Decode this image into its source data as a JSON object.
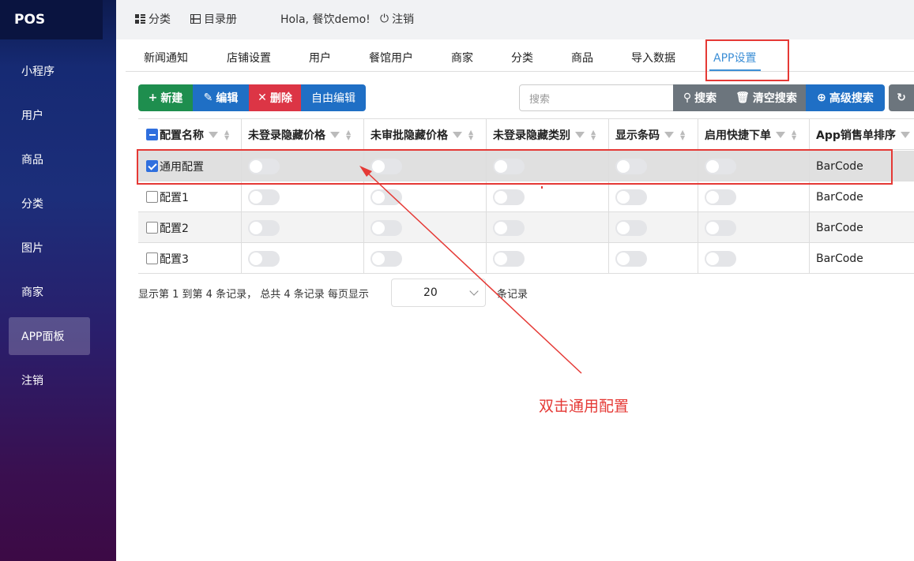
{
  "brand": "POS",
  "sidebar": {
    "items": [
      "小程序",
      "用户",
      "商品",
      "分类",
      "图片",
      "商家",
      "APP面板",
      "注销"
    ],
    "active_index": 6
  },
  "topbar": {
    "category": "分类",
    "directory": "目录册",
    "greeting": "Hola, 餐饮demo!",
    "logout": "注销"
  },
  "tabs": {
    "items": [
      "新闻通知",
      "店铺设置",
      "用户",
      "餐馆用户",
      "商家",
      "分类",
      "商品",
      "导入数据",
      "APP设置"
    ],
    "active": "APP设置"
  },
  "toolbar": {
    "new_label": "新建",
    "edit_label": "编辑",
    "delete_label": "删除",
    "free_edit_label": "自由编辑",
    "search_placeholder": "搜索",
    "search_label": "搜索",
    "clear_label": "清空搜索",
    "advanced_label": "高级搜索"
  },
  "table": {
    "columns": [
      "配置名称",
      "未登录隐藏价格",
      "未审批隐藏价格",
      "未登录隐藏类别",
      "显示条码",
      "启用快捷下单",
      "App销售单排序"
    ],
    "rows": [
      {
        "name": "通用配置",
        "sort": "BarCode",
        "checked": true
      },
      {
        "name": "配置1",
        "sort": "BarCode",
        "checked": false
      },
      {
        "name": "配置2",
        "sort": "BarCode",
        "checked": false
      },
      {
        "name": "配置3",
        "sort": "BarCode",
        "checked": false
      }
    ]
  },
  "pager": {
    "summary": "显示第 1 到第 4 条记录， 总共 4 条记录 每页显示",
    "page_size": "20",
    "suffix": "条记录"
  },
  "annotation": {
    "text": "双击通用配置"
  },
  "colors": {
    "green": "#1e8e4e",
    "blue": "#1f6fc5",
    "red": "#dc3545",
    "gray": "#6c757d",
    "accent": "#3d8fd6",
    "annotation": "#e53935"
  }
}
